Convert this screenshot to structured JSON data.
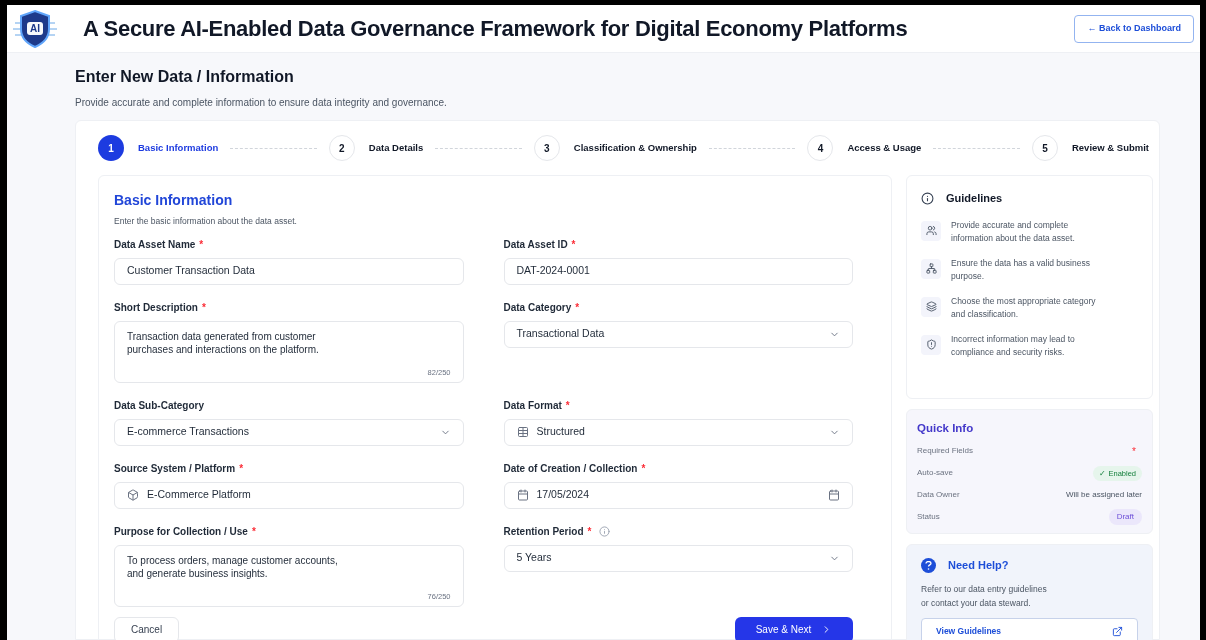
{
  "header": {
    "logo_text": "AI",
    "title": "A Secure AI-Enabled Data Governance Framework for Digital Economy Platforms",
    "back_button": "← Back to Dashboard"
  },
  "page": {
    "title": "Enter New Data / Information",
    "subtitle": "Provide accurate and complete information to ensure data integrity and governance."
  },
  "steps": [
    {
      "number": "1",
      "label": "Basic Information",
      "selected": true
    },
    {
      "number": "2",
      "label": "Data Details",
      "selected": false
    },
    {
      "number": "3",
      "label": "Classification & Ownership",
      "selected": false
    },
    {
      "number": "4",
      "label": "Access & Usage",
      "selected": false
    },
    {
      "number": "5",
      "label": "Review & Submit",
      "selected": false
    }
  ],
  "form": {
    "title": "Basic Information",
    "subtitle": "Enter the basic information about the data asset.",
    "fields": [
      {
        "kind": "text",
        "label": "Data Asset Name",
        "required": true,
        "value": "Customer Transaction Data"
      },
      {
        "kind": "text",
        "label": "Data Asset ID",
        "required": true,
        "value": "DAT-2024-0001"
      },
      {
        "kind": "textarea",
        "label": "Short Description",
        "required": true,
        "value": "Transaction data generated from customer\npurchases and interactions on the platform.",
        "counter": "82/250"
      },
      {
        "kind": "select",
        "label": "Data Category",
        "required": true,
        "value": "Transactional Data"
      },
      {
        "kind": "select",
        "label": "Data Sub-Category",
        "required": false,
        "value": "E-commerce Transactions"
      },
      {
        "kind": "select-with-icon",
        "label": "Data Format",
        "required": true,
        "value": "Structured"
      },
      {
        "kind": "text-with-icon",
        "label": "Source System / Platform",
        "required": true,
        "value": "E-Commerce Platform"
      },
      {
        "kind": "date",
        "label": "Date of Creation / Collection",
        "required": true,
        "value": "17/05/2024"
      },
      {
        "kind": "textarea",
        "label": "Purpose for Collection / Use",
        "required": true,
        "value": "To process orders, manage customer accounts,\nand generate business insights.",
        "counter": "76/250"
      },
      {
        "kind": "select",
        "label": "Retention Period",
        "required": true,
        "info": true,
        "value": "5 Years"
      }
    ],
    "cancel_button": "Cancel",
    "next_button": "Save & Next"
  },
  "guidelines": {
    "title": "Guidelines",
    "items": [
      "Provide accurate and complete information about the data asset.",
      "Ensure the data has a valid business purpose.",
      "Choose the most appropriate category and classification.",
      "Incorrect information may lead to compliance and security risks."
    ]
  },
  "quick_info": {
    "title": "Quick Info",
    "rows": [
      {
        "label": "Required Fields",
        "kind": "mark",
        "value": "*"
      },
      {
        "label": "Auto-save",
        "kind": "enabled",
        "value": "✓ Enabled"
      },
      {
        "label": "Data Owner",
        "kind": "plain",
        "value": "Will be assigned later"
      },
      {
        "label": "Status",
        "kind": "status",
        "value": "Draft"
      }
    ]
  },
  "help": {
    "title": "Need Help?",
    "text": "Refer to our data entry guidelines\nor contact your data steward.",
    "button": "View Guidelines"
  }
}
